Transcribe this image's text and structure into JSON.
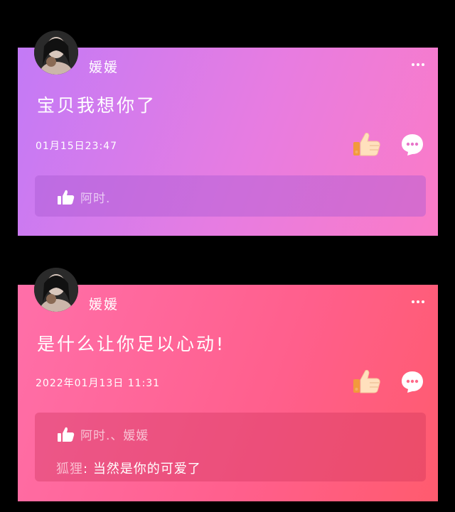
{
  "posts": [
    {
      "username": "媛媛",
      "text": "宝贝我想你了",
      "timestamp": "01月15日23:47",
      "likes": "阿时.",
      "replies": []
    },
    {
      "username": "媛媛",
      "text": "是什么让你足以心动!",
      "timestamp": "2022年01月13日 11:31",
      "likes": "阿时.、媛媛",
      "replies": [
        {
          "author": "狐狸",
          "separator": ":",
          "text": "当然是你的可爱了"
        }
      ]
    }
  ],
  "icons": {
    "more": "more-dots-icon",
    "like": "thumbs-up-icon",
    "comment": "comment-bubble-icon",
    "likes_indicator": "thumbs-up-icon"
  },
  "colors": {
    "background": "#000000",
    "card1_start": "#c37af6",
    "card1_end": "#fb7bc7",
    "card2_start": "#ff6fa9",
    "card2_end": "#ff5b6e"
  }
}
